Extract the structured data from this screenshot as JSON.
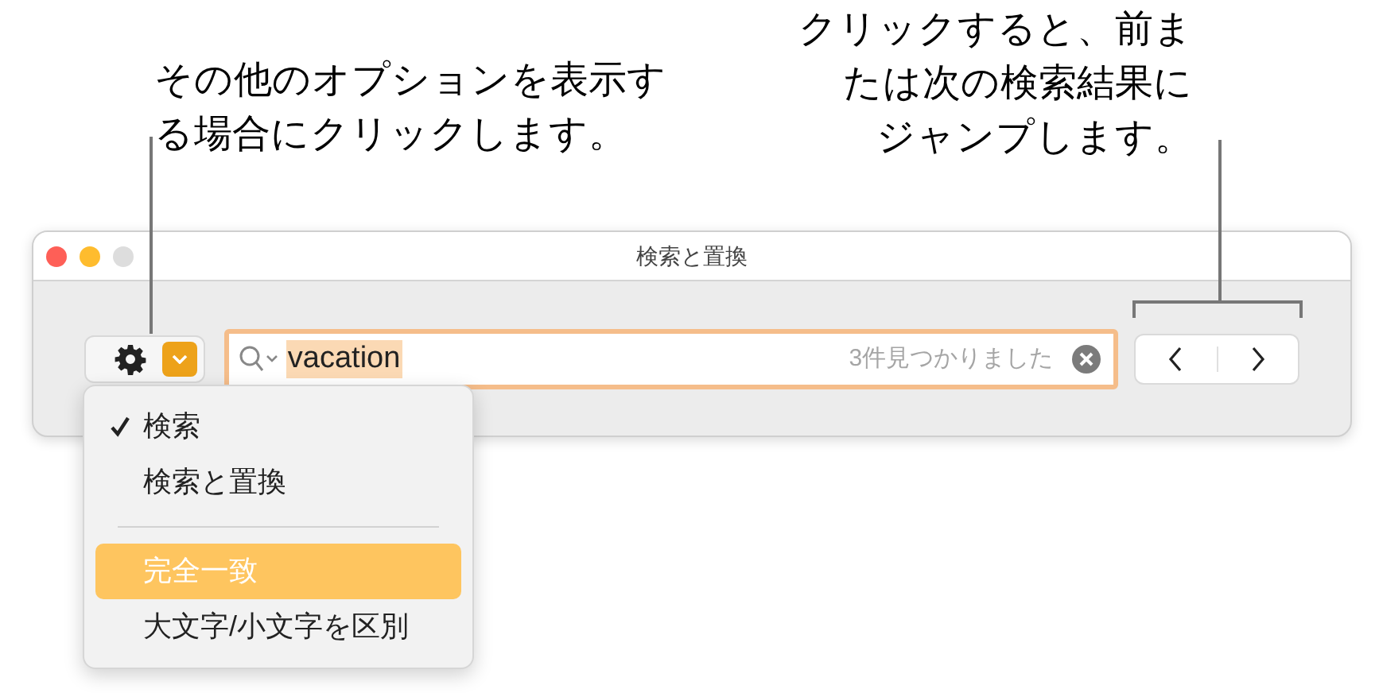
{
  "callouts": [
    {
      "lines": [
        "その他のオプションを表示す",
        "る場合にクリックします。"
      ]
    },
    {
      "lines": [
        "クリックすると、前ま",
        "たは次の検索結果に",
        "ジャンプします。"
      ]
    }
  ],
  "window": {
    "title": "検索と置換"
  },
  "search": {
    "value": "vacation",
    "result": "3件見つかりました"
  },
  "menu": {
    "items": [
      {
        "label": "検索",
        "checked": true,
        "selected": false,
        "kind": "item"
      },
      {
        "label": "検索と置換",
        "checked": false,
        "selected": false,
        "kind": "item"
      },
      {
        "kind": "separator"
      },
      {
        "label": "完全一致",
        "checked": false,
        "selected": true,
        "kind": "item"
      },
      {
        "label": "大文字/小文字を区別",
        "checked": false,
        "selected": false,
        "kind": "item"
      }
    ]
  }
}
